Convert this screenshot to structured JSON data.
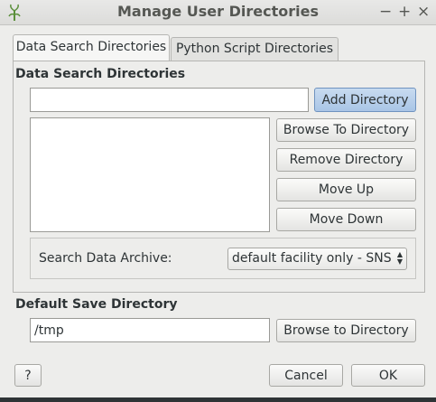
{
  "window": {
    "title": "Manage User Directories",
    "icon": "mantid-app-icon",
    "controls": {
      "minimize": "−",
      "maximize": "+",
      "close": "×"
    }
  },
  "tabs": [
    {
      "label": "Data Search Directories",
      "active": true
    },
    {
      "label": "Python Script Directories",
      "active": false
    }
  ],
  "data_search": {
    "heading": "Data Search Directories",
    "directory_input_value": "",
    "directories": [],
    "add_button": "Add Directory",
    "browse_button": "Browse To Directory",
    "remove_button": "Remove Directory",
    "move_up_button": "Move Up",
    "move_down_button": "Move Down",
    "archive_label": "Search Data Archive:",
    "archive_selected": "default facility only - SNS"
  },
  "default_save": {
    "heading": "Default Save Directory",
    "value": "/tmp",
    "browse_button": "Browse to Directory"
  },
  "footer": {
    "help_button": "?",
    "cancel_button": "Cancel",
    "ok_button": "OK"
  }
}
